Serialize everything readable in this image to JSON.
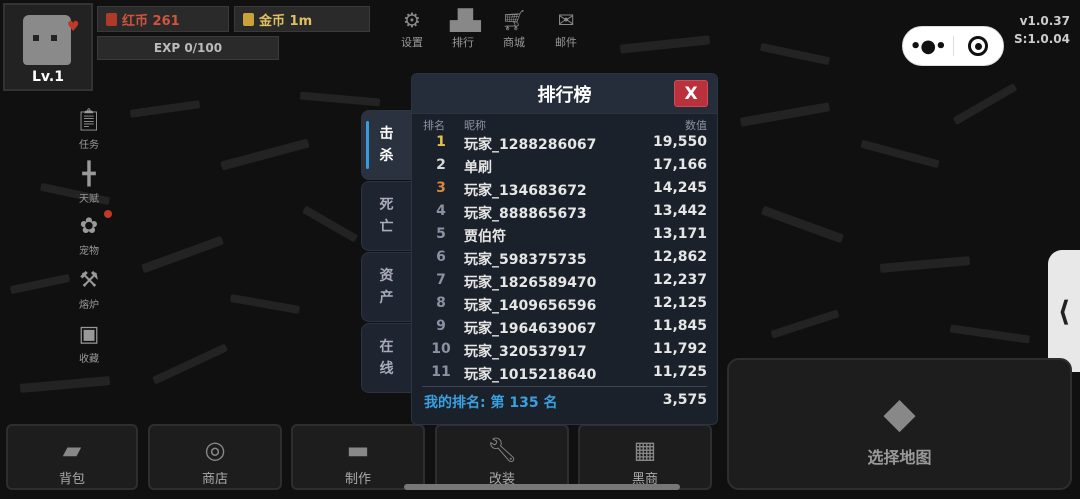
{
  "player": {
    "level": "Lv.1",
    "exp": "EXP 0/100"
  },
  "currency": {
    "red_label": "红币 261",
    "gold_label": "金币 1m"
  },
  "top_menu": [
    {
      "label": "设置",
      "icon": "gear-icon"
    },
    {
      "label": "排行",
      "icon": "podium-icon"
    },
    {
      "label": "商城",
      "icon": "cart-icon"
    },
    {
      "label": "邮件",
      "icon": "mail-icon"
    }
  ],
  "version": {
    "client": "v1.0.37",
    "server": "S:1.0.04"
  },
  "side_menu": [
    {
      "label": "任务",
      "icon": "clipboard-check-icon"
    },
    {
      "label": "天赋",
      "icon": "dumbbell-icon"
    },
    {
      "label": "宠物",
      "icon": "paw-icon"
    },
    {
      "label": "熔炉",
      "icon": "hammer-icon"
    },
    {
      "label": "收藏",
      "icon": "archive-icon"
    }
  ],
  "bottom_menu": [
    {
      "label": "背包",
      "icon": "backpack-icon"
    },
    {
      "label": "商店",
      "icon": "coins-icon"
    },
    {
      "label": "制作",
      "icon": "anvil-icon"
    },
    {
      "label": "改装",
      "icon": "wrench-icon"
    },
    {
      "label": "黑商",
      "icon": "gold-bars-icon"
    }
  ],
  "map_button": {
    "label": "选择地图",
    "icon": "map-icon"
  },
  "leaderboard": {
    "title": "排行榜",
    "close_label": "X",
    "tabs": [
      {
        "line1": "击",
        "line2": "杀",
        "active": true
      },
      {
        "line1": "死",
        "line2": "亡",
        "active": false
      },
      {
        "line1": "资",
        "line2": "产",
        "active": false
      },
      {
        "line1": "在",
        "line2": "线",
        "active": false
      }
    ],
    "columns": {
      "rank": "排名",
      "name": "昵称",
      "value": "数值"
    },
    "rows": [
      {
        "rank": "1",
        "name": "玩家_1288286067",
        "value": "19,550"
      },
      {
        "rank": "2",
        "name": "单刷",
        "value": "17,166"
      },
      {
        "rank": "3",
        "name": "玩家_134683672",
        "value": "14,245"
      },
      {
        "rank": "4",
        "name": "玩家_888865673",
        "value": "13,442"
      },
      {
        "rank": "5",
        "name": "贾伯符",
        "value": "13,171"
      },
      {
        "rank": "6",
        "name": "玩家_598375735",
        "value": "12,862"
      },
      {
        "rank": "7",
        "name": "玩家_1826589470",
        "value": "12,237"
      },
      {
        "rank": "8",
        "name": "玩家_1409656596",
        "value": "12,125"
      },
      {
        "rank": "9",
        "name": "玩家_1964639067",
        "value": "11,845"
      },
      {
        "rank": "10",
        "name": "玩家_320537917",
        "value": "11,792"
      },
      {
        "rank": "11",
        "name": "玩家_1015218640",
        "value": "11,725"
      }
    ],
    "my_rank_label": "我的排名: 第 135 名",
    "my_value": "3,575"
  },
  "colors": {
    "accent_blue": "#3aa0e0",
    "close_red": "#b8313b",
    "gold": "#e3c34a",
    "bronze": "#d9883a"
  }
}
